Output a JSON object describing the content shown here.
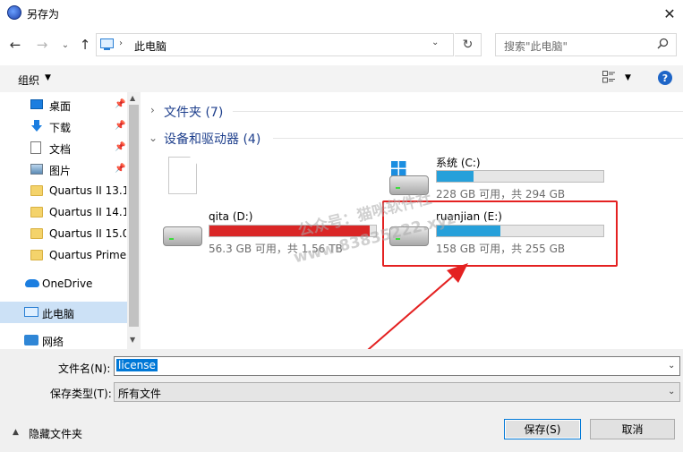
{
  "window": {
    "title": "另存为"
  },
  "nav": {
    "back": "←",
    "forward": "→",
    "up": "↑",
    "history": "⌄"
  },
  "address": {
    "chevron": "›",
    "path": "此电脑",
    "refresh": "↻"
  },
  "search": {
    "placeholder": "搜索\"此电脑\""
  },
  "toolbar": {
    "organize": "组织",
    "help": "?"
  },
  "sidebar": {
    "items": [
      {
        "label": "桌面",
        "icon": "desktop-icon",
        "pinned": true
      },
      {
        "label": "下载",
        "icon": "download-icon",
        "pinned": true
      },
      {
        "label": "文档",
        "icon": "document-icon",
        "pinned": true
      },
      {
        "label": "图片",
        "icon": "picture-icon",
        "pinned": true
      },
      {
        "label": "Quartus II 13.1",
        "icon": "folder-icon"
      },
      {
        "label": "Quartus II 14.1",
        "icon": "folder-icon"
      },
      {
        "label": "Quartus II 15.0",
        "icon": "folder-icon"
      },
      {
        "label": "Quartus Prime",
        "icon": "folder-icon"
      },
      {
        "label": "OneDrive",
        "icon": "cloud-icon"
      },
      {
        "label": "此电脑",
        "icon": "computer-icon",
        "selected": true
      },
      {
        "label": "网络",
        "icon": "network-icon"
      }
    ]
  },
  "groups": {
    "folders": {
      "label": "文件夹 (7)"
    },
    "devices": {
      "label": "设备和驱动器 (4)"
    }
  },
  "drives": {
    "c": {
      "name": "系统 (C:)",
      "info": "228 GB 可用，共 294 GB",
      "used_fraction": 0.22,
      "color": "#26a0da"
    },
    "d": {
      "name": "qita (D:)",
      "info": "56.3 GB 可用，共 1.56 TB",
      "used_fraction": 0.96,
      "color": "#da2626"
    },
    "e": {
      "name": "ruanjian (E:)",
      "info": "158 GB 可用，共 255 GB",
      "used_fraction": 0.38,
      "color": "#26a0da"
    }
  },
  "watermark": {
    "line1": "公众号：猫咪软件社",
    "line2": "www.83835222.xyz"
  },
  "form": {
    "filename_label": "文件名(N):",
    "filename_value": "license",
    "filetype_label": "保存类型(T):",
    "filetype_value": "所有文件"
  },
  "footer": {
    "hide_folders": "隐藏文件夹",
    "save": "保存(S)",
    "cancel": "取消"
  },
  "colors": {
    "accent": "#0078d7",
    "highlight_box": "#e42121",
    "arrow": "#e42121"
  }
}
